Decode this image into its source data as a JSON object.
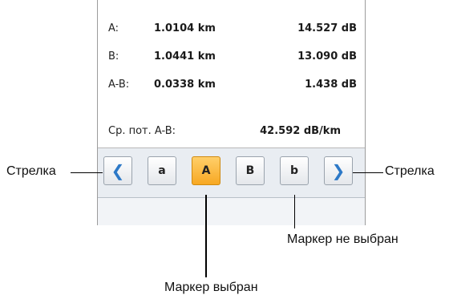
{
  "readings": {
    "rows": [
      {
        "label": "A:",
        "distance": "1.0104 km",
        "loss": "14.527 dB"
      },
      {
        "label": "B:",
        "distance": "1.0441 km",
        "loss": "13.090 dB"
      },
      {
        "label": "A-B:",
        "distance": "0.0338 km",
        "loss": "1.438 dB"
      }
    ],
    "avg_label": "Ср. пот. A-B:",
    "avg_value": "42.592 dB/km"
  },
  "toolbar": {
    "left_arrow": "❮",
    "right_arrow": "❯",
    "markers": [
      "a",
      "A",
      "B",
      "b"
    ],
    "selected_marker": "A",
    "selected_color": "#f7a823",
    "arrow_color": "#2d79c7"
  },
  "annotations": {
    "left_arrow": "Стрелка",
    "right_arrow": "Стрелка",
    "unselected_marker": "Маркер не выбран",
    "selected_marker": "Маркер выбран"
  }
}
